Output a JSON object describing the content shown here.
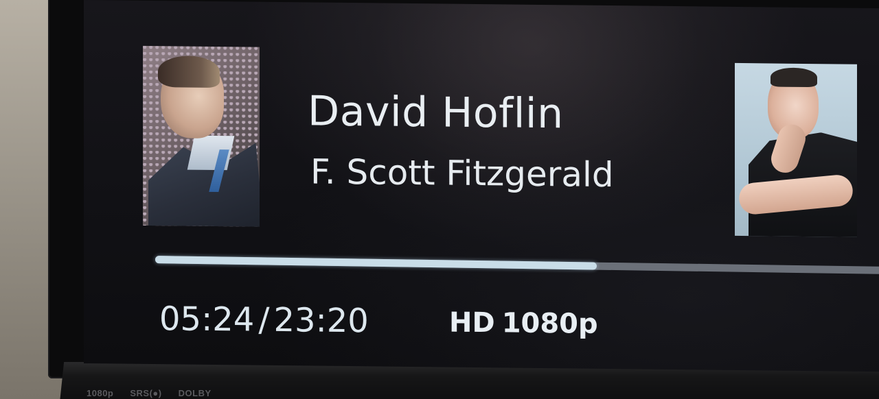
{
  "now_playing": {
    "title": "David Hoflin",
    "subtitle": "F. Scott Fitzgerald"
  },
  "playback": {
    "elapsed": "05:24",
    "separator": "/",
    "duration": "23:20",
    "progress_fraction": 0.595
  },
  "quality": {
    "hd_badge": "HD",
    "resolution": "1080p"
  },
  "tv_bezel": {
    "logos": [
      "1080p",
      "SRS(●)",
      "DOLBY"
    ]
  },
  "colors": {
    "progress_fill": "#c9dde8",
    "progress_track": "#6b7079",
    "text": "#e9eef2"
  }
}
